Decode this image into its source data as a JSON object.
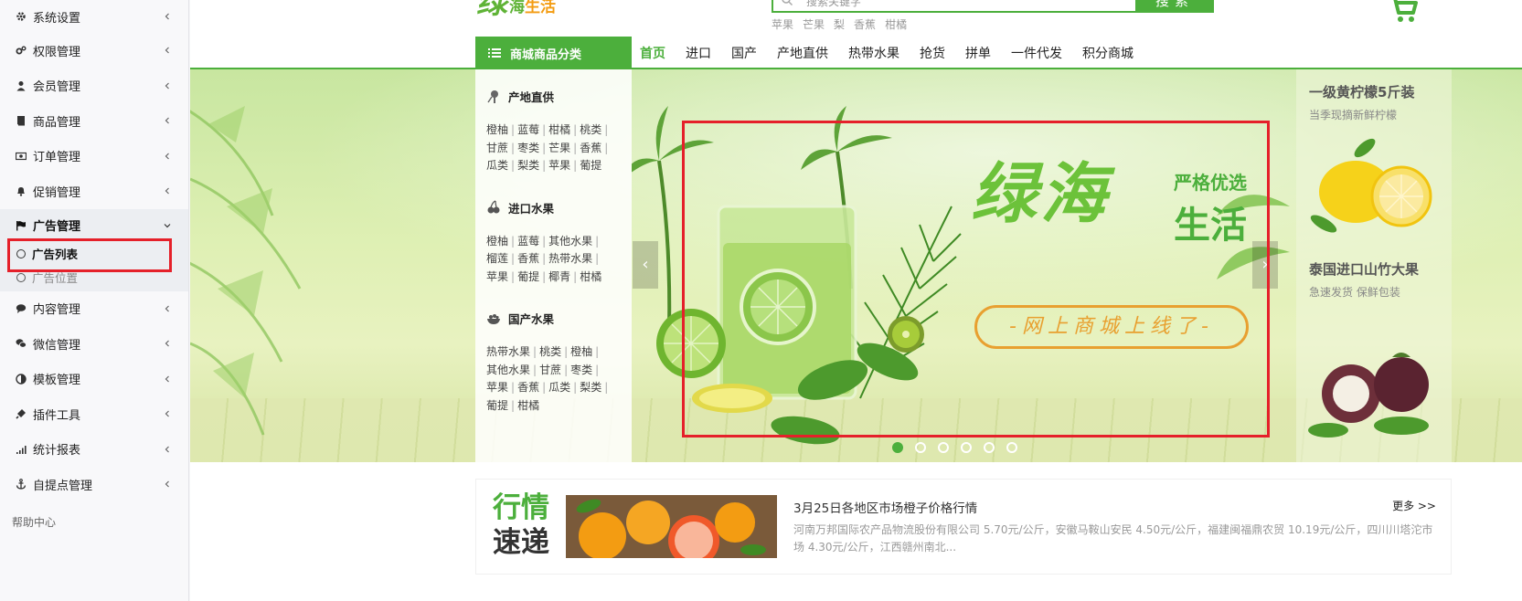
{
  "sidebar": {
    "items": [
      {
        "label": "系统设置",
        "icon": "gear-icon"
      },
      {
        "label": "权限管理",
        "icon": "cogs-icon"
      },
      {
        "label": "会员管理",
        "icon": "user-icon"
      },
      {
        "label": "商品管理",
        "icon": "book-icon"
      },
      {
        "label": "订单管理",
        "icon": "money-icon"
      },
      {
        "label": "促销管理",
        "icon": "bell-icon"
      },
      {
        "label": "广告管理",
        "icon": "flag-icon"
      },
      {
        "label": "内容管理",
        "icon": "comment-icon"
      },
      {
        "label": "微信管理",
        "icon": "wechat-icon"
      },
      {
        "label": "模板管理",
        "icon": "contrast-icon"
      },
      {
        "label": "插件工具",
        "icon": "plug-icon"
      },
      {
        "label": "统计报表",
        "icon": "signal-icon"
      },
      {
        "label": "自提点管理",
        "icon": "anchor-icon"
      }
    ],
    "submenu": [
      {
        "label": "广告列表"
      },
      {
        "label": "广告位置"
      }
    ],
    "help": "帮助中心"
  },
  "header": {
    "logo_big": "绿",
    "logo_small_a": "海",
    "logo_small_b": "生活",
    "search_placeholder": "搜索关键字",
    "search_button": "搜索",
    "hot_words": [
      "苹果",
      "芒果",
      "梨",
      "香蕉",
      "柑橘"
    ]
  },
  "nav": {
    "category_button": "商城商品分类",
    "links": [
      "首页",
      "进口",
      "国产",
      "产地直供",
      "热带水果",
      "抢货",
      "拼单",
      "一件代发",
      "积分商城"
    ]
  },
  "categories": [
    {
      "title": "产地直供",
      "icon": "tree-icon",
      "rows": [
        [
          "橙柚",
          "蓝莓",
          "柑橘",
          "桃类"
        ],
        [
          "甘蔗",
          "枣类",
          "芒果",
          "香蕉"
        ],
        [
          "瓜类",
          "梨类",
          "苹果",
          "葡提"
        ]
      ]
    },
    {
      "title": "进口水果",
      "icon": "cherry-icon",
      "rows": [
        [
          "橙柚",
          "蓝莓",
          "其他水果"
        ],
        [
          "榴莲",
          "香蕉",
          "热带水果"
        ],
        [
          "苹果",
          "葡提",
          "椰青",
          "柑橘"
        ]
      ]
    },
    {
      "title": "国产水果",
      "icon": "bowl-icon",
      "rows": [
        [
          "热带水果",
          "桃类",
          "橙柚"
        ],
        [
          "其他水果",
          "甘蔗",
          "枣类"
        ],
        [
          "苹果",
          "香蕉",
          "瓜类",
          "梨类"
        ],
        [
          "葡提",
          "柑橘"
        ]
      ]
    }
  ],
  "banner": {
    "brand": "绿海",
    "tag1": "严格优选",
    "tag2": "生活",
    "slogan": "-网上商城上线了-",
    "dot_count": 6,
    "active_dot": 0
  },
  "promo": {
    "title1": "一级黄柠檬5斤装",
    "sub1": "当季现摘新鲜柠檬",
    "title2": "泰国进口山竹大果",
    "sub2": "急速发货 保鲜包装"
  },
  "news": {
    "label_1": "行情",
    "label_2": "速递",
    "title": "3月25日各地区市场橙子价格行情",
    "more": "更多 >>",
    "text": "河南万邦国际农产品物流股份有限公司 5.70元/公斤，安徽马鞍山安民 4.50元/公斤，福建闽福鼎农贸 10.19元/公斤，四川川塔沱市场 4.30元/公斤，江西赣州南北..."
  },
  "colors": {
    "accent": "#4caf3c",
    "highlight": "#e5202a",
    "slogan": "#e8a030"
  }
}
